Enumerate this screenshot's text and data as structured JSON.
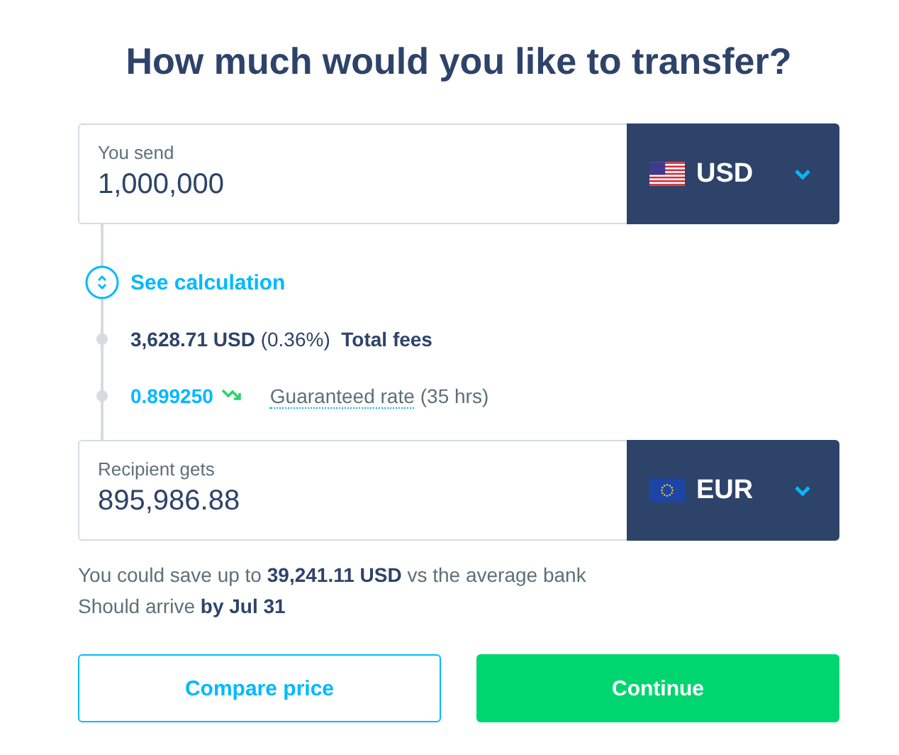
{
  "title": "How much would you like to transfer?",
  "send": {
    "label": "You send",
    "value": "1,000,000",
    "currency": "USD"
  },
  "calculation": {
    "link": "See calculation",
    "expanded": false
  },
  "fees": {
    "text": "**3,628.71 USD** (0.36%)  **Total fees**"
  },
  "rate": {
    "value": "0.899250",
    "link": "Guaranteed rate",
    "suffix": "(35 hrs)"
  },
  "recipient": {
    "label": "Recipient gets",
    "value": "895,986.88",
    "currency": "EUR"
  },
  "notes": [
    "You could save up to **39,241.11 USD** vs the average bank",
    "Should arrive **by Jul 31**"
  ],
  "buttons": [
    {
      "label": "Compare price",
      "kind": "secondary"
    },
    {
      "label": "Continue",
      "kind": "primary"
    }
  ]
}
